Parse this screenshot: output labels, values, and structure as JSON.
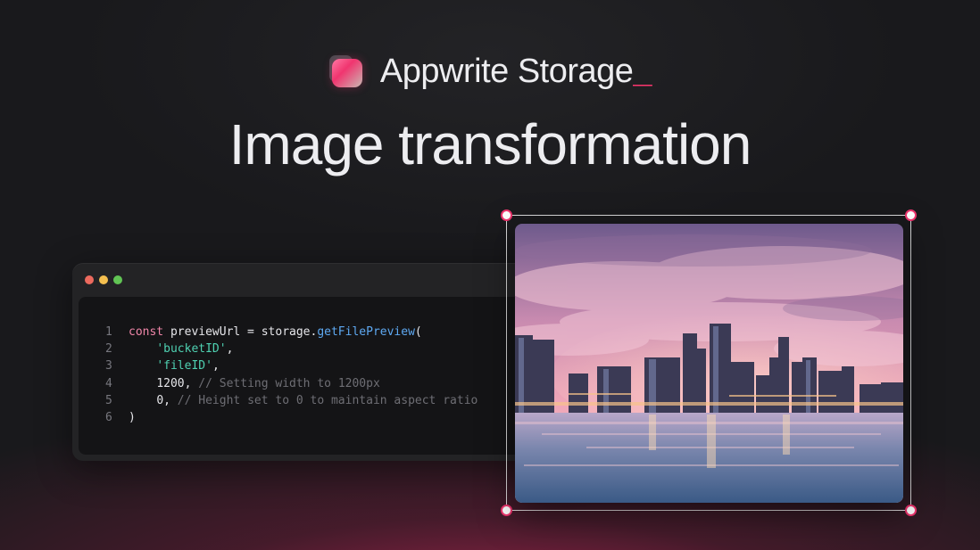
{
  "brand": {
    "logo_icon": "appwrite-storage-folder-icon",
    "title": "Appwrite Storage",
    "cursor": "_",
    "accent_color": "#fd366e"
  },
  "headline": "Image transformation",
  "code_window": {
    "window_controls": [
      "close-dot",
      "minimize-dot",
      "maximize-dot"
    ],
    "lines": [
      {
        "n": "1",
        "p1": "const",
        "p2": " previewUrl = storage.",
        "p3": "getFilePreview",
        "p4": "("
      },
      {
        "n": "2",
        "indent": "    ",
        "str": "'bucketID'",
        "rest": ","
      },
      {
        "n": "3",
        "indent": "    ",
        "str": "'fileID'",
        "rest": ","
      },
      {
        "n": "4",
        "indent": "    ",
        "val": "1200, ",
        "cmt": "// Setting width to 1200px"
      },
      {
        "n": "5",
        "indent": "    ",
        "val": "0, ",
        "cmt": "// Height set to 0 to maintain aspect ratio"
      },
      {
        "n": "6",
        "val": ")"
      }
    ]
  },
  "image_preview": {
    "subject": "city-skyline-at-sunset-photo",
    "selection_handles": [
      "top-left",
      "top-right",
      "bottom-left",
      "bottom-right"
    ]
  }
}
